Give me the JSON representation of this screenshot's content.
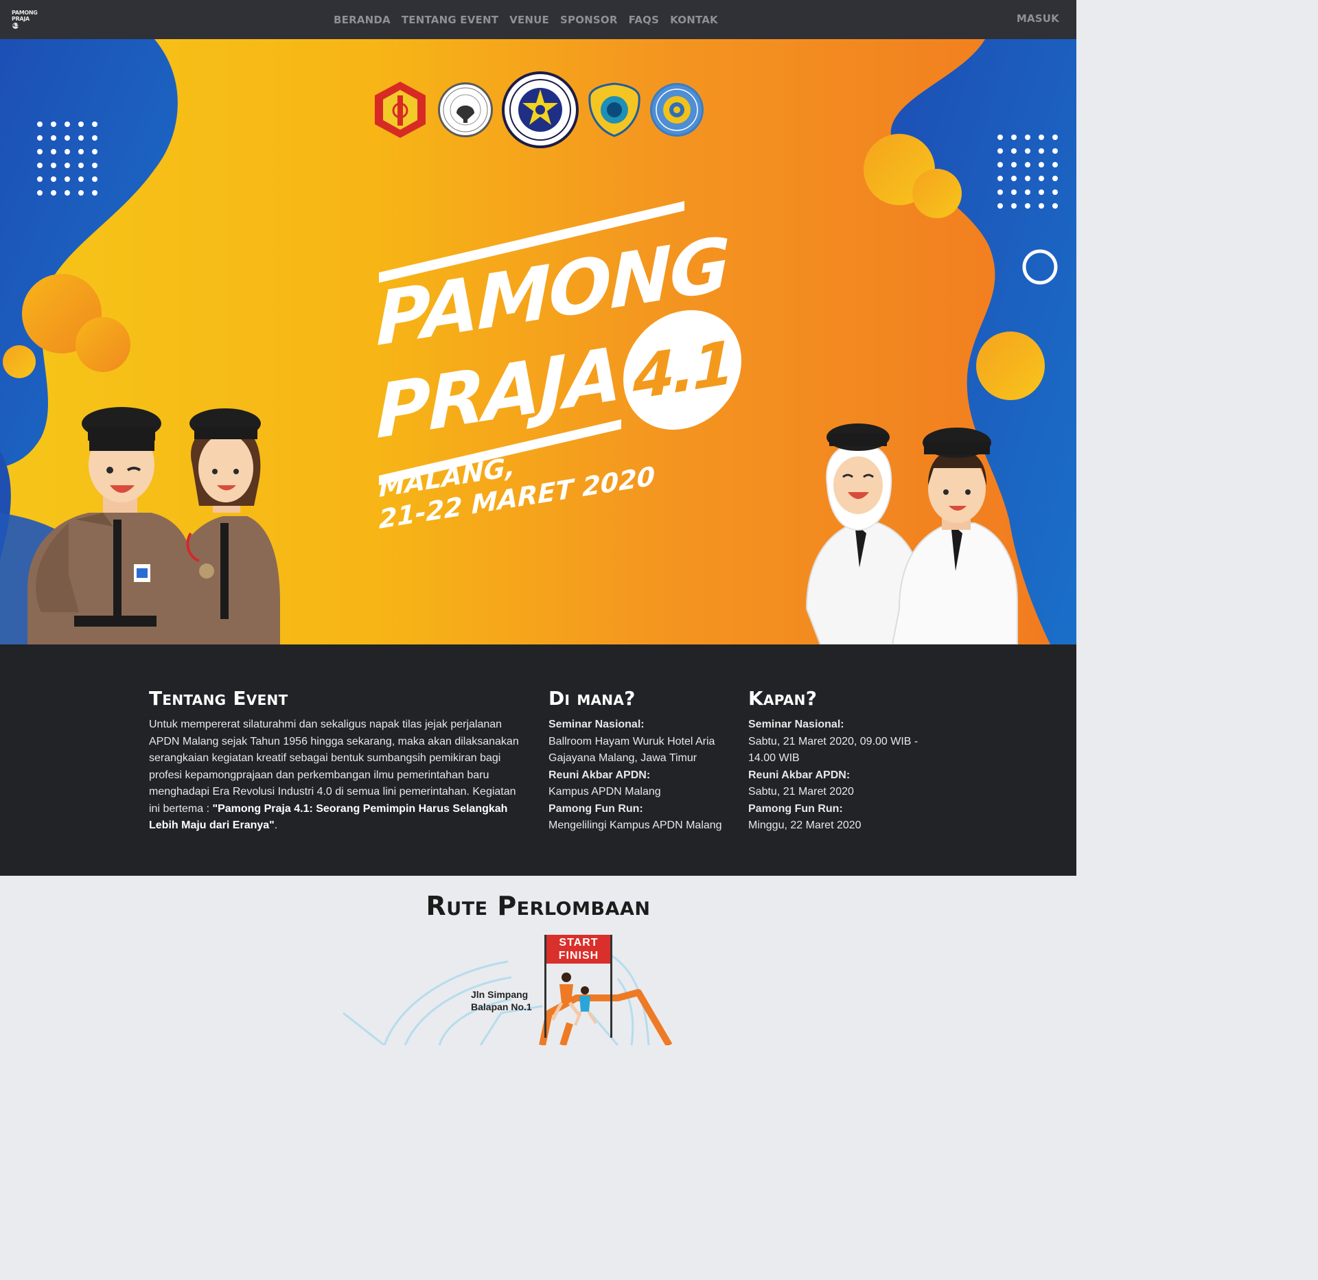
{
  "nav": {
    "logo_line1": "PAMONG",
    "logo_line2": "PRAJA",
    "logo_badge": "4.1",
    "links": [
      "Beranda",
      "Tentang Event",
      "Venue",
      "Sponsor",
      "FAQs",
      "Kontak"
    ],
    "login": "Masuk"
  },
  "hero": {
    "title_line1": "PAMONG",
    "title_line2": "PRAJA",
    "version": "4.1",
    "sub_line1": "MALANG,",
    "sub_line2": "21-22 MARET 2020",
    "logos": [
      "police-emblem",
      "departemen-dalam-negeri-seal",
      "ikaptk-seal",
      "shield-emblem",
      "ipdn-seal"
    ],
    "colors": {
      "yellow": "#f6c518",
      "orange": "#f17a20",
      "blue": "#1e56b8"
    }
  },
  "about": {
    "heading": "Tentang Event",
    "body": "Untuk mempererat silaturahmi dan sekaligus napak tilas jejak perjalanan APDN Malang sejak Tahun 1956 hingga sekarang, maka akan dilaksanakan serangkaian kegiatan kreatif sebagai bentuk sumbangsih pemikiran bagi profesi kepamongprajaan dan perkembangan ilmu pemerintahan baru menghadapi Era Revolusi Industri 4.0 di semua lini pemerintahan. Kegiatan ini bertema : ",
    "theme": "\"Pamong Praja 4.1: Seorang Pemimpin Harus Selangkah Lebih Maju dari Eranya\"",
    "end": "."
  },
  "where": {
    "heading": "Di mana?",
    "items": [
      {
        "label": "Seminar Nasional:",
        "value": "Ballroom Hayam Wuruk Hotel Aria Gajayana Malang, Jawa Timur"
      },
      {
        "label": "Reuni Akbar APDN:",
        "value": "Kampus APDN Malang"
      },
      {
        "label": "Pamong Fun Run:",
        "value": "Mengelilingi Kampus APDN Malang"
      }
    ]
  },
  "when": {
    "heading": "Kapan?",
    "items": [
      {
        "label": "Seminar Nasional:",
        "value": "Sabtu, 21 Maret 2020, 09.00 WIB - 14.00 WIB"
      },
      {
        "label": "Reuni Akbar APDN:",
        "value": "Sabtu, 21 Maret 2020"
      },
      {
        "label": "Pamong Fun Run:",
        "value": "Minggu, 22 Maret 2020"
      }
    ]
  },
  "route": {
    "heading": "Rute Perlombaan",
    "street_label_1": "Jln Simpang",
    "street_label_2": "Balapan No.1",
    "flag_line1": "START",
    "flag_line2": "FINISH"
  }
}
